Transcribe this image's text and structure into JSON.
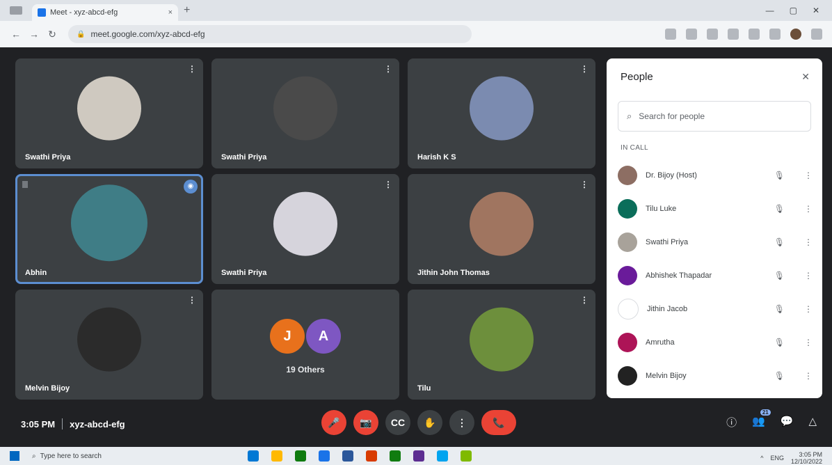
{
  "browser": {
    "tab_title": "Meet - xyz-abcd-efg",
    "tab_close": "×",
    "new_tab": "+",
    "window_controls": [
      "—",
      "▢",
      "✕"
    ],
    "back": "←",
    "forward": "→",
    "reload": "↻",
    "url": "meet.google.com/xyz-abcd-efg"
  },
  "tiles": [
    {
      "name": "Swathi Priya",
      "color": "#cfc9c0"
    },
    {
      "name": "Swathi Priya",
      "color": "#4a4a4a"
    },
    {
      "name": "Harish K S",
      "color": "#7b8bb0"
    },
    {
      "name": "Abhin",
      "color": "#3f7d86"
    },
    {
      "name": "Swathi Priya",
      "color": "#d6d4dc"
    },
    {
      "name": "Jithin John Thomas",
      "color": "#a07560"
    },
    {
      "name": "Melvin Bijoy",
      "color": "#2b2b2b"
    },
    {
      "name": "19 Others",
      "avatars": [
        "J",
        "A"
      ],
      "colors": [
        "#e8711c",
        "#7e57c2"
      ]
    },
    {
      "name": "Tilu",
      "color": "#6d8f3c"
    }
  ],
  "tile_more": "⋮",
  "speaking_badge": "◉",
  "people_panel": {
    "title": "People",
    "close": "✕",
    "search_placeholder": "Search for people",
    "section": "IN CALL",
    "participants": [
      {
        "name": "Dr. Bijoy (Host)",
        "color": "#8d6e63"
      },
      {
        "name": "Tilu Luke",
        "color": "#0b6e5a"
      },
      {
        "name": "Swathi Priya",
        "color": "#a8a29a"
      },
      {
        "name": "Abhishek Thapadar",
        "color": "#6a1b9a"
      },
      {
        "name": "Jithin Jacob",
        "color": "#ffffff"
      },
      {
        "name": "Amrutha",
        "color": "#ad1457"
      },
      {
        "name": "Melvin Bijoy",
        "color": "#222222"
      }
    ],
    "mic_icon": "🎙",
    "dots_icon": "⋮"
  },
  "bottom": {
    "time": "3:05 PM",
    "meeting_code": "xyz-abcd-efg",
    "controls": [
      "🎤",
      "📷",
      "CC",
      "✋",
      "⋮",
      "📞"
    ],
    "right_controls": [
      "ⓘ",
      "👥",
      "💬",
      "△"
    ],
    "people_count": "21"
  },
  "taskbar": {
    "search_text": "Type here to search",
    "time": "3:05 PM",
    "date": "12/10/2022",
    "tray": [
      "^",
      "ENG"
    ],
    "app_colors": [
      "#0078d4",
      "#ffb900",
      "#0f7b0f",
      "#1a73e8",
      "#2b579a",
      "#d83b01",
      "#107c10",
      "#5c2d91",
      "#00a4ef",
      "#7fba00"
    ]
  }
}
